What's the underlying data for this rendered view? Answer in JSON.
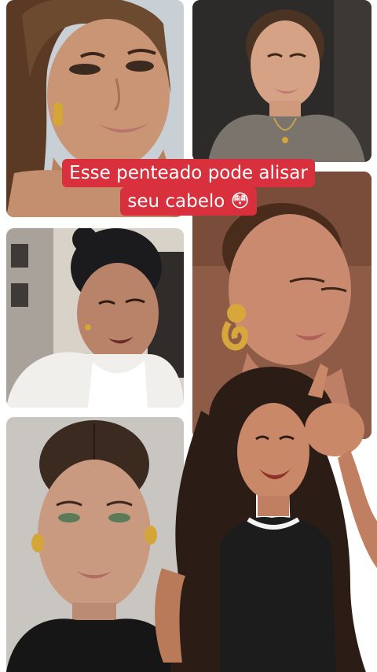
{
  "caption": {
    "line1": "Esse penteado pode alisar",
    "line2": "seu cabelo 😳"
  },
  "tiles": [
    {
      "subject": "woman-sleek-ponytail-gold-hoops",
      "dominant_color": "#b88866"
    },
    {
      "subject": "woman-slicked-bun-gray-top-necklace",
      "dominant_color": "#2d2b29"
    },
    {
      "subject": "woman-slicked-bun-white-fur-street",
      "dominant_color": "#d8d2c9"
    },
    {
      "subject": "woman-slicked-back-gold-knot-earring",
      "dominant_color": "#8e5b46"
    },
    {
      "subject": "woman-middle-part-bun-black-top",
      "dominant_color": "#c9c5c1"
    }
  ],
  "creator": {
    "subject": "woman-curly-hair-black-tank-top-waving",
    "hair_color": "#2b1d15",
    "top_color": "#1c1c1c"
  },
  "colors": {
    "caption_background": "#d9303e",
    "caption_text": "#ffffff",
    "page_background": "#ffffff"
  }
}
